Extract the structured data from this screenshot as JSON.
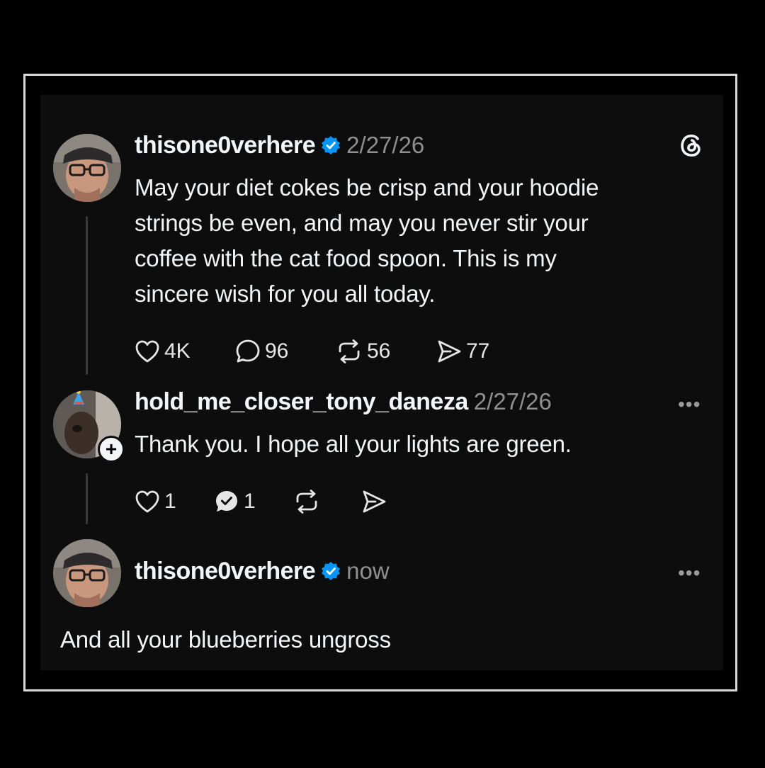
{
  "posts": [
    {
      "username": "thisone0verhere",
      "verified": true,
      "timestamp": "2/27/26",
      "text_lines": [
        "May your diet cokes be crisp and your hoodie",
        "strings be even, and may you never stir your",
        "coffee with the cat food spoon. This is my",
        "sincere wish for you all today."
      ],
      "likes": "4K",
      "replies": "96",
      "reposts": "56",
      "shares": "77"
    },
    {
      "username": "hold_me_closer_tony_daneza",
      "verified": false,
      "timestamp": "2/27/26",
      "text": "Thank you.  I hope all your lights are green.",
      "likes": "1",
      "replies": "1",
      "follow_badge": "+"
    },
    {
      "username": "thisone0verhere",
      "verified": true,
      "timestamp": "now",
      "text": "And all your blueberries ungross"
    }
  ],
  "icons": {
    "app_logo": "threads-logo-icon",
    "like": "heart-icon",
    "reply": "comment-icon",
    "repost": "repost-icon",
    "share": "send-icon",
    "more": "more-options-icon",
    "verified": "verified-badge-icon"
  },
  "more_label": "•••",
  "colors": {
    "background": "#000000",
    "card": "#0d0d0d",
    "text": "#f3f5f7",
    "muted": "#8f8f8f",
    "verified": "#0095f6",
    "frame_border": "#d9d9d9"
  }
}
